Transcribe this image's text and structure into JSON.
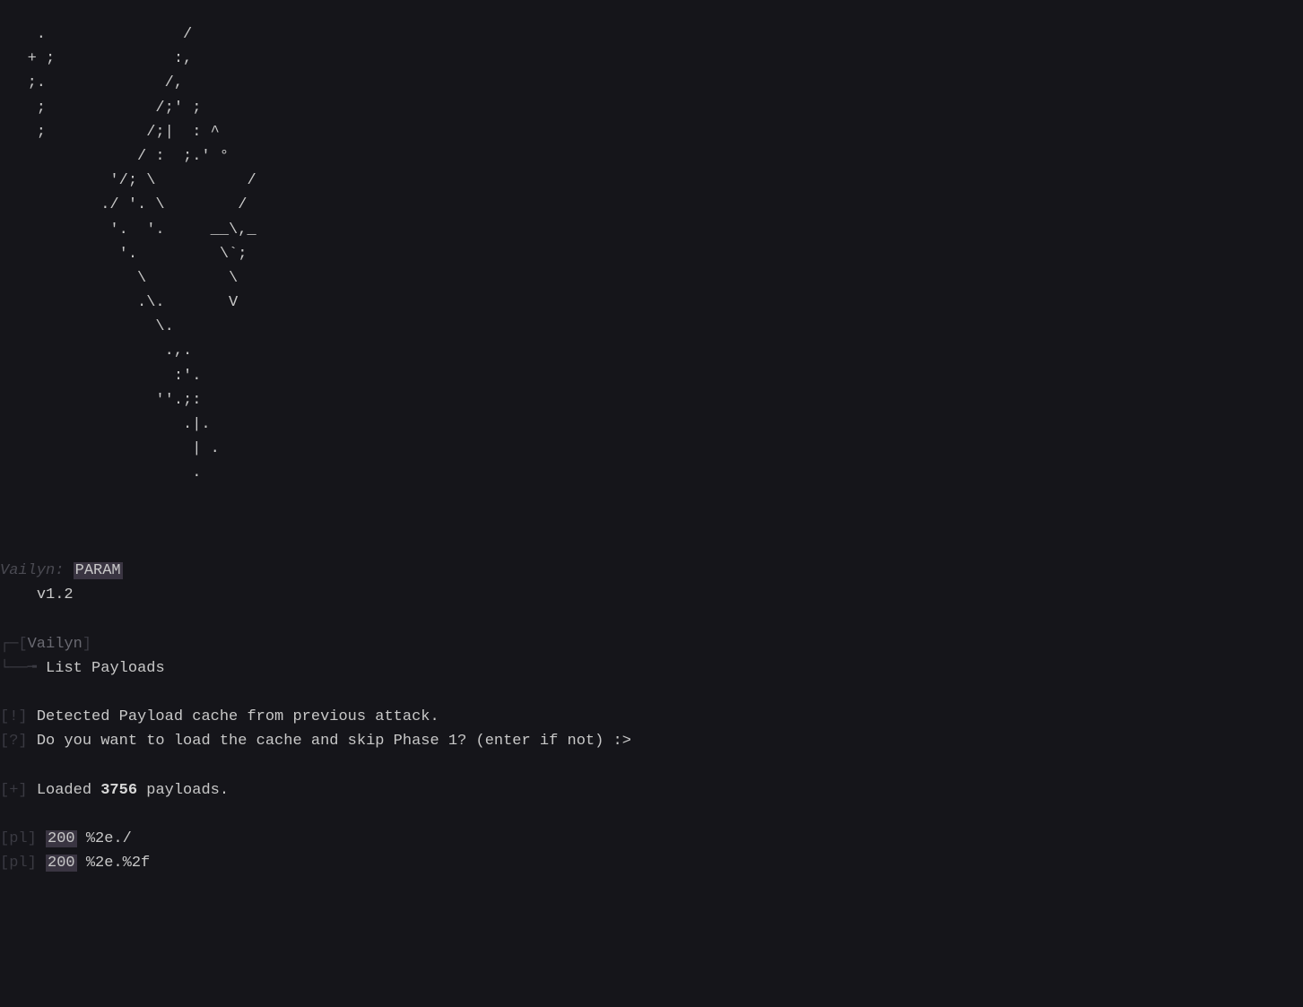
{
  "ascii_art": "    .               /\n   + ;             :,\n   ;.             /,\n    ;            /;' ;\n    ;           /;|  : ^\n               / :  ;.' °\n            '/; \\          /\n           ./ '. \\        /\n            '.  '.     __\\,_\n             '.         \\`;\n               \\         \\\n               .\\.       V\n                 \\.\n                  .,.\n                   :'.\n                 ''.;:\n                    .|.\n                     | .\n                     .",
  "banner": {
    "app_label": "Vailyn:",
    "mode": "PARAM",
    "version": "v1.2"
  },
  "section": {
    "box_corner1": "┌─[",
    "title": "Vailyn",
    "box_corner2": "]",
    "box_line": "└──╼ ",
    "subtitle": "List Payloads"
  },
  "messages": {
    "exclaim_prefix": "[!]",
    "question_prefix": "[?]",
    "plus_prefix": "[+]",
    "detected": "Detected Payload cache from previous attack.",
    "prompt": "Do you want to load the cache and skip Phase 1? (enter if not) :>",
    "loaded_pre": "Loaded ",
    "loaded_count": "3756",
    "loaded_post": " payloads."
  },
  "payloads": [
    {
      "prefix": "[pl]",
      "status": "200",
      "value": "%2e./"
    },
    {
      "prefix": "[pl]",
      "status": "200",
      "value": "%2e.%2f"
    }
  ]
}
